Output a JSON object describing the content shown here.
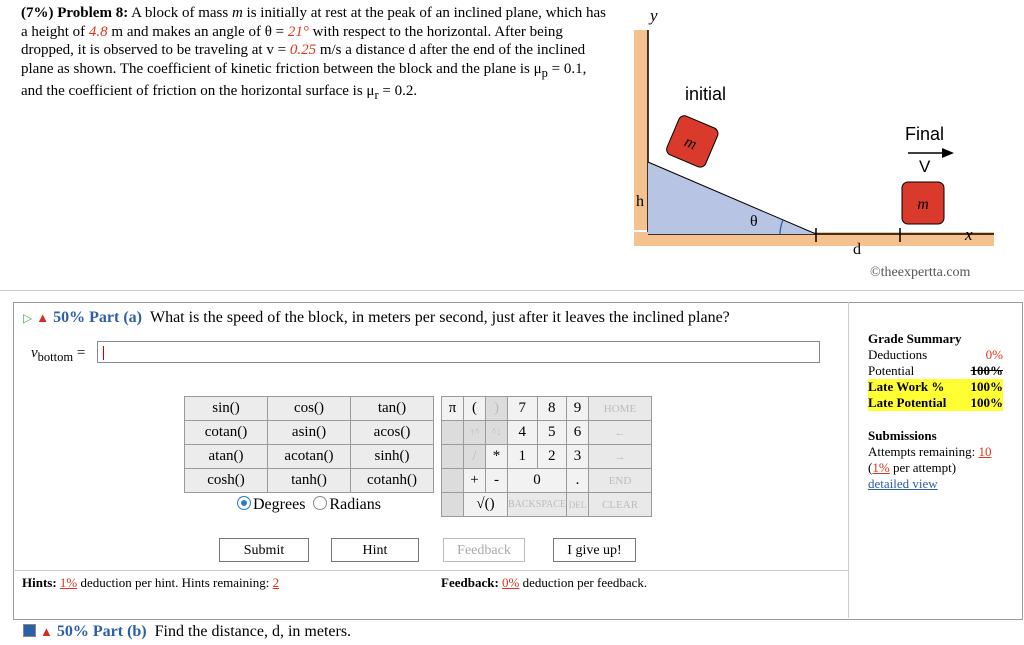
{
  "problem": {
    "prefix": "(7%) Problem 8:",
    "t1": " A block of mass ",
    "m": "m",
    "t2": " is initially at rest at the peak of an inclined plane, which has a height of ",
    "height": "4.8",
    "t3": " m and makes an angle of θ = ",
    "angle": "21°",
    "t4": " with respect to the horizontal. After being dropped, it is observed to be traveling at v = ",
    "speed": "0.25",
    "t5": " m/s a distance d after the end of the inclined plane as shown. The coefficient of kinetic friction between the block and the plane is μ",
    "sub_p": "p",
    "t6": " = 0.1, and the coefficient of friction on the horizontal surface is μ",
    "sub_r": "r",
    "t7": " = 0.2."
  },
  "figure": {
    "y_label": "y",
    "initial_label": "initial",
    "final_label": "Final",
    "v_label": "V",
    "block_label": "m",
    "h_label": "h",
    "theta_label": "θ",
    "d_label": "d",
    "x_label": "x",
    "copyright": "©theexpertta.com"
  },
  "part_a": {
    "percent": "50%",
    "label": "Part (a)",
    "question": "What is the speed of the block, in meters per second, just after it leaves the inclined plane?",
    "var": "v",
    "var_sub": "bottom",
    "eq": "="
  },
  "keypad": {
    "functions": [
      [
        "sin()",
        "cos()",
        "tan()"
      ],
      [
        "cotan()",
        "asin()",
        "acos()"
      ],
      [
        "atan()",
        "acotan()",
        "sinh()"
      ],
      [
        "cosh()",
        "tanh()",
        "cotanh()"
      ]
    ],
    "pi": "π",
    "lparen": "(",
    "rparen": ")",
    "up": "↑^",
    "down": "^↓",
    "slash": "/",
    "star": "*",
    "plus": "+",
    "minus": "-",
    "sqrt": "√()",
    "backspace": "BACKSPACE",
    "del": "DEL",
    "clear": "CLEAR",
    "home": "HOME",
    "left": "←",
    "right": "→",
    "end": "END",
    "dot": ".",
    "digits": [
      "7",
      "8",
      "9",
      "4",
      "5",
      "6",
      "1",
      "2",
      "3",
      "0"
    ],
    "degrees": "Degrees",
    "radians": "Radians"
  },
  "buttons": {
    "submit": "Submit",
    "hint": "Hint",
    "feedback": "Feedback",
    "give_up": "I give up!"
  },
  "hints": {
    "label": "Hints:",
    "pct": "1%",
    "t1": " deduction per hint. Hints remaining: ",
    "remaining": "2"
  },
  "feedback": {
    "label": "Feedback:",
    "pct": "0%",
    "t1": " deduction per feedback."
  },
  "grade": {
    "title": "Grade Summary",
    "deductions_label": "Deductions",
    "deductions_val": "0%",
    "potential_label": "Potential",
    "potential_val": "100%",
    "late_work_label": "Late Work %",
    "late_work_val": "100%",
    "late_potential_label": "Late Potential",
    "late_potential_val": "100%",
    "submissions_title": "Submissions",
    "attempts_label": "Attempts remaining:",
    "attempts_val": "10",
    "per_attempt_pct": "1%",
    "per_attempt_text": " per attempt)",
    "detailed": "detailed view"
  },
  "part_b": {
    "percent": "50%",
    "label": "Part (b)",
    "question": "Find the distance, d, in meters."
  },
  "colors": {
    "accent_blue": "#2c5fa8",
    "red_value": "#e0351b",
    "highlight": "#ffff33",
    "incline": "#b7c4e4",
    "ground": "#f5c28f",
    "block": "#d93a2b"
  }
}
